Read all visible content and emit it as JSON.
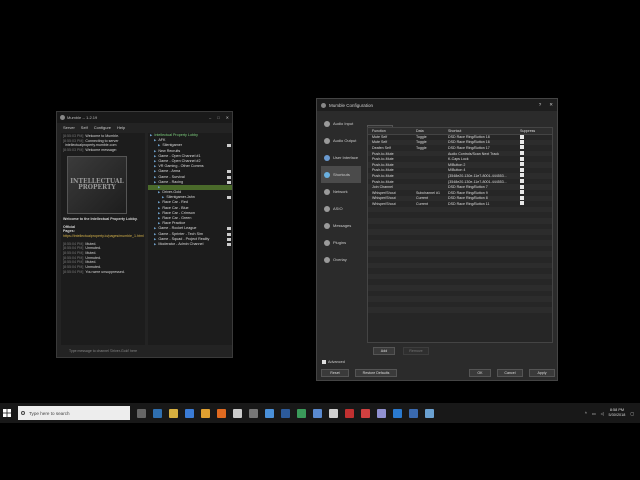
{
  "mumble": {
    "title": "Mumble -- 1.2.19",
    "menu": [
      "Server",
      "Self",
      "Configure",
      "Help"
    ],
    "log": [
      {
        "ts": "[8:55:03 PM]",
        "text": "Welcome to Mumble."
      },
      {
        "ts": "[8:55:03 PM]",
        "text": "Connecting to server"
      },
      {
        "ts": "",
        "text": "intellectualproperty.mumble.com"
      },
      {
        "ts": "[8:55:03 PM]",
        "text": "Welcome message:"
      }
    ],
    "logo_text": "INTELLECTUAL PROPERTY",
    "welcome_text": "Welcome to the Intellectual Property Lobby.",
    "official_label": "Official",
    "pages_label": "Pages:",
    "pages_link": "https://intellectualproperty.io/pages/mumble_1.html",
    "log2": [
      {
        "ts": "[8:55:04 PM]",
        "text": "Muted."
      },
      {
        "ts": "[8:55:04 PM]",
        "text": "Unmuted."
      },
      {
        "ts": "[8:55:04 PM]",
        "text": "Muted."
      },
      {
        "ts": "[8:55:04 PM]",
        "text": "Unmuted."
      },
      {
        "ts": "[8:55:04 PM]",
        "text": "Muted."
      },
      {
        "ts": "[8:55:04 PM]",
        "text": "Unmuted."
      },
      {
        "ts": "[8:55:04 PM]",
        "text": "You were unsuppressed."
      }
    ],
    "tree": [
      {
        "indent": 0,
        "label": "Intellectual Property Lobby",
        "color": "#7fd07f",
        "icons": false,
        "sel": false
      },
      {
        "indent": 1,
        "label": "AFK",
        "color": "#ddd",
        "icons": false,
        "sel": false
      },
      {
        "indent": 2,
        "label": "Silentgamer",
        "color": "#ddd",
        "icons": true,
        "sel": false
      },
      {
        "indent": 1,
        "label": "New Recruits",
        "color": "#ddd",
        "icons": false,
        "sel": false
      },
      {
        "indent": 1,
        "label": "Game - Open Channel #1",
        "color": "#ddd",
        "icons": false,
        "sel": false
      },
      {
        "indent": 1,
        "label": "Game - Open Channel #2",
        "color": "#ddd",
        "icons": false,
        "sel": false
      },
      {
        "indent": 1,
        "label": "VR Gaming - Other Comms",
        "color": "#ddd",
        "icons": false,
        "sel": false
      },
      {
        "indent": 1,
        "label": "Game - Arma",
        "color": "#ddd",
        "icons": true,
        "sel": false
      },
      {
        "indent": 1,
        "label": "Game - Survival",
        "color": "#ddd",
        "icons": true,
        "sel": false
      },
      {
        "indent": 1,
        "label": "Game - Racing",
        "color": "#ddd",
        "icons": true,
        "sel": false
      },
      {
        "indent": 2,
        "label": "",
        "color": "#ddd",
        "icons": false,
        "sel": true
      },
      {
        "indent": 2,
        "label": "Driver-Gold",
        "color": "#ddd",
        "icons": false,
        "sel": false
      },
      {
        "indent": 3,
        "label": "Silentgamer.Jahn",
        "color": "#ddd",
        "icons": true,
        "sel": false
      },
      {
        "indent": 2,
        "label": "Race Car - Red",
        "color": "#ddd",
        "icons": false,
        "sel": false
      },
      {
        "indent": 2,
        "label": "Race Car - Blue",
        "color": "#ddd",
        "icons": false,
        "sel": false
      },
      {
        "indent": 2,
        "label": "Race Car - Crimson",
        "color": "#ddd",
        "icons": false,
        "sel": false
      },
      {
        "indent": 2,
        "label": "Race Car - Green",
        "color": "#ddd",
        "icons": false,
        "sel": false
      },
      {
        "indent": 2,
        "label": "Race Practice",
        "color": "#ddd",
        "icons": false,
        "sel": false
      },
      {
        "indent": 1,
        "label": "Game - Rocket League",
        "color": "#ddd",
        "icons": true,
        "sel": false
      },
      {
        "indent": 1,
        "label": "Game - Sprinter - Tech Sim",
        "color": "#ddd",
        "icons": true,
        "sel": false
      },
      {
        "indent": 1,
        "label": "Game - Squad - Project Reality",
        "color": "#ddd",
        "icons": true,
        "sel": false
      },
      {
        "indent": 1,
        "label": "Moderator - Admin Channel",
        "color": "#ddd",
        "icons": true,
        "sel": false
      }
    ],
    "chat_placeholder": "Type message to channel 'Driver-Gold' here"
  },
  "config": {
    "title": "Mumble Configuration",
    "help_btn": "?",
    "close_btn": "✕",
    "sidebar": [
      {
        "label": "Audio Input",
        "color": "#9a9a9a",
        "active": false
      },
      {
        "label": "Audio Output",
        "color": "#9a9a9a",
        "active": false
      },
      {
        "label": "User Interface",
        "color": "#6a9ad0",
        "active": false
      },
      {
        "label": "Shortcuts",
        "color": "#6ab0e0",
        "active": true
      },
      {
        "label": "Network",
        "color": "#9a9a9a",
        "active": false
      },
      {
        "label": "ASIO",
        "color": "#9a9a9a",
        "active": false
      },
      {
        "label": "Messages",
        "color": "#9a9a9a",
        "active": false
      },
      {
        "label": "Plugins",
        "color": "#9a9a9a",
        "active": false
      },
      {
        "label": "Overlay",
        "color": "#9a9a9a",
        "active": false
      }
    ],
    "tab": "Shortcuts",
    "columns": [
      "Function",
      "Data",
      "Shortcut",
      "Suppress"
    ],
    "rows": [
      [
        "Mute Self",
        "Toggle",
        "DSD Race Ring/Button 18"
      ],
      [
        "Mute Self",
        "Toggle",
        "DSD Race Ring/Button 16"
      ],
      [
        "Deafen Self",
        "Toggle",
        "DSD Race Ring/Button 17"
      ],
      [
        "Push-to-Mute",
        "",
        "Audio Controls/Scan Next Track"
      ],
      [
        "Push-to-Mute",
        "",
        "K-Caps Lock"
      ],
      [
        "Push-to-Mute",
        "",
        "M/Button 2"
      ],
      [
        "Push-to-Mute",
        "",
        "M/Button 4"
      ],
      [
        "Push-to-Mute",
        "",
        "{3548e20-130e-11e7-8001-444553..."
      ],
      [
        "Push-to-Mute",
        "",
        "{3548e20-130e-11e7-8001-444553..."
      ],
      [
        "Join Channel",
        "",
        "DSD Race Ring/Button 7"
      ],
      [
        "Whisper/Shout",
        "Subchannel #1",
        "DSD Race Ring/Button 9"
      ],
      [
        "Whisper/Shout",
        "Current",
        "DSD Race Ring/Button 8"
      ],
      [
        "Whisper/Shout",
        "Current",
        "DSD Race Ring/Button 11"
      ]
    ],
    "add_btn": "Add",
    "remove_btn": "Remove",
    "advanced_label": "Advanced",
    "reset_btn": "Reset",
    "restore_btn": "Restore Defaults",
    "ok_btn": "OK",
    "cancel_btn": "Cancel",
    "apply_btn": "Apply"
  },
  "taskbar": {
    "search_placeholder": "Type here to search",
    "icons": [
      "task-view",
      "edge",
      "explorer",
      "store",
      "chrome",
      "firefox",
      "mumble",
      "unknown-1",
      "unknown-2",
      "unknown-3",
      "unknown-4",
      "unknown-5",
      "unknown-6",
      "unknown-7",
      "unknown-8",
      "unknown-9",
      "unknown-10",
      "unknown-11",
      "unknown-12"
    ],
    "icon_colors": [
      "#666",
      "#2f6fb0",
      "#d8b040",
      "#3a7bd5",
      "#e0a030",
      "#e06a20",
      "#ccc",
      "#777",
      "#4a90d9",
      "#2c5a9a",
      "#3a9a5a",
      "#5a8ad0",
      "#d0d0d0",
      "#c03030",
      "#d04040",
      "#9090d0",
      "#2a7ad0",
      "#3a6ab0",
      "#6aa0d0"
    ],
    "time": "8:58 PM",
    "date": "5/30/2018"
  }
}
